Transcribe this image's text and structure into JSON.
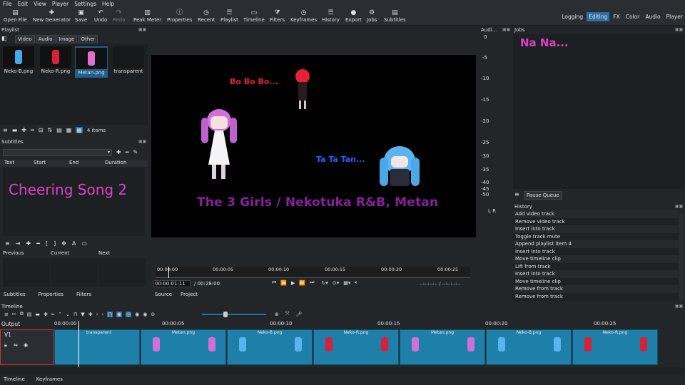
{
  "menu": [
    "File",
    "Edit",
    "View",
    "Player",
    "Settings",
    "Help"
  ],
  "toolbar": [
    {
      "label": "Open File",
      "icon": "folder-icon",
      "disabled": false
    },
    {
      "label": "New Generator",
      "icon": "plus-icon",
      "disabled": false
    },
    {
      "label": "Save",
      "icon": "save-icon",
      "disabled": false
    },
    {
      "label": "Undo",
      "icon": "undo-icon",
      "disabled": false
    },
    {
      "label": "Redo",
      "icon": "redo-icon",
      "disabled": true
    },
    {
      "label": "Peak Meter",
      "icon": "meter-icon",
      "disabled": false
    },
    {
      "label": "Properties",
      "icon": "info-icon",
      "disabled": false
    },
    {
      "label": "Recent",
      "icon": "clock-icon",
      "disabled": false
    },
    {
      "label": "Playlist",
      "icon": "list-icon",
      "disabled": false
    },
    {
      "label": "Timeline",
      "icon": "timeline-icon",
      "disabled": false
    },
    {
      "label": "Filters",
      "icon": "filter-icon",
      "disabled": false
    },
    {
      "label": "Keyframes",
      "icon": "keyframe-icon",
      "disabled": false
    },
    {
      "label": "History",
      "icon": "history-icon",
      "disabled": false
    },
    {
      "label": "Export",
      "icon": "export-icon",
      "disabled": false
    },
    {
      "label": "Jobs",
      "icon": "gear-icon",
      "disabled": false
    },
    {
      "label": "Subtitles",
      "icon": "subtitle-icon",
      "disabled": false
    }
  ],
  "layouts": [
    "Logging",
    "Editing",
    "FX",
    "Color",
    "Audio",
    "Player"
  ],
  "active_layout": "Editing",
  "playlist": {
    "title": "Playlist",
    "tabs": [
      "Video",
      "Audio",
      "Image",
      "Other"
    ],
    "items": [
      "Neko-B.png",
      "Neko-R.png",
      "Metan.png",
      "transparent"
    ],
    "count": "4 items"
  },
  "subtitles": {
    "title": "Subtitles",
    "columns": [
      "Text",
      "Start",
      "End",
      "Duration"
    ],
    "preview_text": "Cheering Song 2",
    "nav": [
      "Previous",
      "Current",
      "Next"
    ]
  },
  "left_tabs": [
    "Subtitles",
    "Properties",
    "Filters"
  ],
  "player": {
    "texts": {
      "bo": "Bo Bo Bo...",
      "ta": "Ta Ta Tan...",
      "title": "The 3 Girls / Nekotuka R&B, Metan"
    },
    "ruler": [
      "00:00:00",
      "00:00:05",
      "00:00:10",
      "00:00:15",
      "00:00:20",
      "00:00:25"
    ],
    "timecode": "00:00:01:11",
    "duration": "/ 00:28:00",
    "inout": "--:--:--:-- / --:--:--:--",
    "tabs": [
      "Source",
      "Project"
    ]
  },
  "audio": {
    "title": "Audi...",
    "scale": [
      "0",
      "-5",
      "-10",
      "-15",
      "-20",
      "-25",
      "-30",
      "-35",
      "-40",
      "-45",
      "-50"
    ],
    "lr": "L R"
  },
  "jobs": {
    "title": "Jobs",
    "preview_text": "Na Na...",
    "pause": "Pause Queue"
  },
  "history": {
    "title": "History",
    "items": [
      "Add video track",
      "Remove video track",
      "Insert into track",
      "Toggle track mute",
      "Append playlist item 4",
      "Insert into track",
      "Move timeline clip",
      "Lift from track",
      "Insert into track",
      "Move timeline clip",
      "Remove from track",
      "Remove from track"
    ]
  },
  "timeline": {
    "title": "Timeline",
    "output": "Output",
    "track": "V1",
    "ruler": [
      "00:00:00",
      "00:00:05",
      "00:00:10",
      "00:00:15",
      "00:00:20",
      "00:00:25"
    ],
    "clips": [
      "transparent",
      "Metan.png",
      "Neko-B.png",
      "Neko-R.png",
      "Metan.png",
      "Neko-B.png",
      "Neko-R.png"
    ]
  },
  "bottom_tabs": [
    "Timeline",
    "Keyframes"
  ],
  "colors": {
    "accent": "#2f6ea3",
    "clip": "#1e7fa8",
    "pink": "#e040c8",
    "red": "#e8203a",
    "blue": "#2060ff",
    "purple": "#8a1fa0"
  }
}
